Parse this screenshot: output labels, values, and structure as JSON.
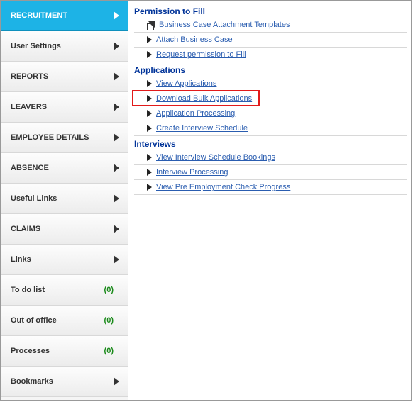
{
  "sidebar": {
    "items": [
      {
        "label": "RECRUITMENT",
        "active": true
      },
      {
        "label": "User Settings"
      },
      {
        "label": "REPORTS"
      },
      {
        "label": "LEAVERS"
      },
      {
        "label": "EMPLOYEE DETAILS"
      },
      {
        "label": "ABSENCE"
      },
      {
        "label": "Useful Links"
      },
      {
        "label": "CLAIMS"
      },
      {
        "label": "Links"
      },
      {
        "label": "To do list",
        "count": "(0)",
        "no_arrow": true
      },
      {
        "label": "Out of office",
        "count": "(0)",
        "no_arrow": true
      },
      {
        "label": "Processes",
        "count": "(0)",
        "no_arrow": true
      },
      {
        "label": "Bookmarks"
      }
    ]
  },
  "content": {
    "sections": [
      {
        "title": "Permission to Fill",
        "links": [
          {
            "label": "Business Case Attachment Templates",
            "icon": "ext"
          },
          {
            "label": "Attach Business Case",
            "icon": "tri"
          },
          {
            "label": "Request permission to Fill",
            "icon": "tri"
          }
        ]
      },
      {
        "title": "Applications",
        "links": [
          {
            "label": "View Applications",
            "icon": "tri"
          },
          {
            "label": "Download Bulk Applications",
            "icon": "tri",
            "highlighted": true
          },
          {
            "label": "Application Processing",
            "icon": "tri"
          },
          {
            "label": "Create Interview Schedule",
            "icon": "tri"
          }
        ]
      },
      {
        "title": "Interviews",
        "links": [
          {
            "label": "View Interview Schedule Bookings",
            "icon": "tri"
          },
          {
            "label": "Interview Processing",
            "icon": "tri"
          },
          {
            "label": "View Pre Employment Check Progress",
            "icon": "tri"
          }
        ]
      }
    ]
  }
}
